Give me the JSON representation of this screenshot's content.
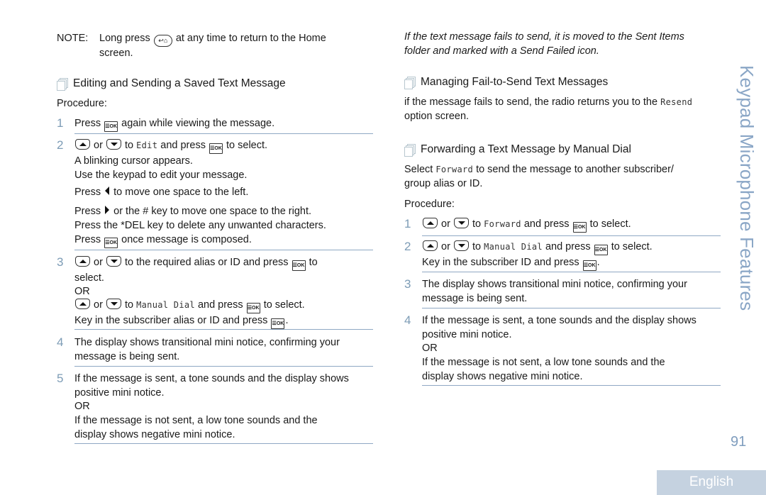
{
  "side_title": "Keypad Microphone Features",
  "page_number": "91",
  "language_tab": "English",
  "colors": {
    "accent": "#8aa6c6",
    "step_number": "#7d9cb6",
    "rule": "#8fa8c4",
    "lang_tab_bg": "#c5d2e0"
  },
  "icons": {
    "section": "stacked-pages-icon",
    "ok_key": "menu-ok-key-icon",
    "up_key": "up-arrow-key-icon",
    "down_key": "down-arrow-key-icon",
    "home_key": "back-home-key-icon",
    "left_arrow": "left-arrow-icon",
    "right_arrow": "right-arrow-icon"
  },
  "left": {
    "note": {
      "label": "NOTE:",
      "pre": "Long press",
      "post": "at any time to return to the Home",
      "line2": "screen."
    },
    "section_title": "Editing and Sending a Saved Text Message",
    "procedure_label": "Procedure:",
    "steps": [
      {
        "num": "1",
        "press": "Press",
        "rest": "again while viewing the message."
      },
      {
        "num": "2",
        "or": "or",
        "to": "to",
        "menu": "Edit",
        "and_press": "and press",
        "to_select": "to select.",
        "l2": "A blinking cursor appears.",
        "l3": "Use the keypad to edit your message.",
        "l4_pre": "Press",
        "l4_post": "to move one space to the left.",
        "l5_pre": "Press",
        "l5_post": "or the # key to move one space to the right.",
        "l6": "Press the *DEL key to delete any unwanted characters.",
        "l7_pre": "Press",
        "l7_post": "once message is composed."
      },
      {
        "num": "3",
        "or": "or",
        "l1_mid": "to the required alias or ID and press",
        "l1_end": "to",
        "l2": "select.",
        "l3": "OR",
        "to": "to",
        "menu": "Manual Dial",
        "and_press": "and press",
        "to_select": "to select.",
        "l5": "Key in the subscriber alias or ID and press",
        "period": "."
      },
      {
        "num": "4",
        "l1": "The display shows transitional mini notice, confirming your",
        "l2": "message is being sent."
      },
      {
        "num": "5",
        "l1": "If the message is sent, a tone sounds and the display shows",
        "l2": "positive mini notice.",
        "l3": "OR",
        "l4": "If the message is not sent, a low tone sounds and the",
        "l5": "display shows negative mini notice."
      }
    ]
  },
  "right": {
    "intro_l1": "If the text message fails to send, it is moved to the Sent Items",
    "intro_l2": "folder and marked with a Send Failed icon.",
    "section1_title": "Managing Fail-to-Send Text Messages",
    "section1_l1": "if the message fails to send, the radio returns you to the",
    "section1_menu": "Resend",
    "section1_l2": "option screen.",
    "section2_title": "Forwarding a Text Message by Manual Dial",
    "section2_pre": "Select",
    "section2_menu": "Forward",
    "section2_l1": "to send the message to another subscriber/",
    "section2_l2": "group alias or ID.",
    "procedure_label": "Procedure:",
    "steps": [
      {
        "num": "1",
        "or": "or",
        "to": "to",
        "menu": "Forward",
        "and_press": "and press",
        "to_select": "to select."
      },
      {
        "num": "2",
        "or": "or",
        "to": "to",
        "menu": "Manual Dial",
        "and_press": "and press",
        "to_select": "to select.",
        "l2": "Key in the subscriber ID and press",
        "period": "."
      },
      {
        "num": "3",
        "l1": "The display shows transitional mini notice, confirming your",
        "l2": "message is being sent."
      },
      {
        "num": "4",
        "l1": "If the message is sent, a tone sounds and the display shows",
        "l2": "positive mini notice.",
        "l3": "OR",
        "l4": "If the message is not sent, a low tone sounds and the",
        "l5": "display shows negative mini notice."
      }
    ]
  }
}
